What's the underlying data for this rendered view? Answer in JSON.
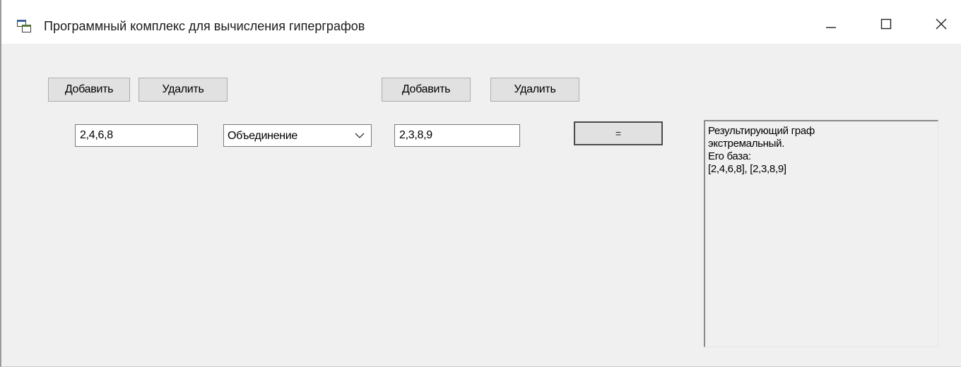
{
  "window": {
    "title": "Программный комплекс для вычисления гиперграфов",
    "controls": {
      "minimize": "minimize-icon",
      "maximize": "maximize-icon",
      "close": "close-icon"
    }
  },
  "left_set": {
    "add_label": "Добавить",
    "remove_label": "Удалить",
    "value": "2,4,6,8"
  },
  "operation": {
    "selected": "Объединение"
  },
  "right_set": {
    "add_label": "Добавить",
    "remove_label": "Удалить",
    "value": "2,3,8,9"
  },
  "compute_button": {
    "label": "="
  },
  "result": {
    "lines": [
      "Результирующий граф",
      "экстремальный.",
      "Его база:",
      "[2,4,6,8], [2,3,8,9]"
    ]
  }
}
